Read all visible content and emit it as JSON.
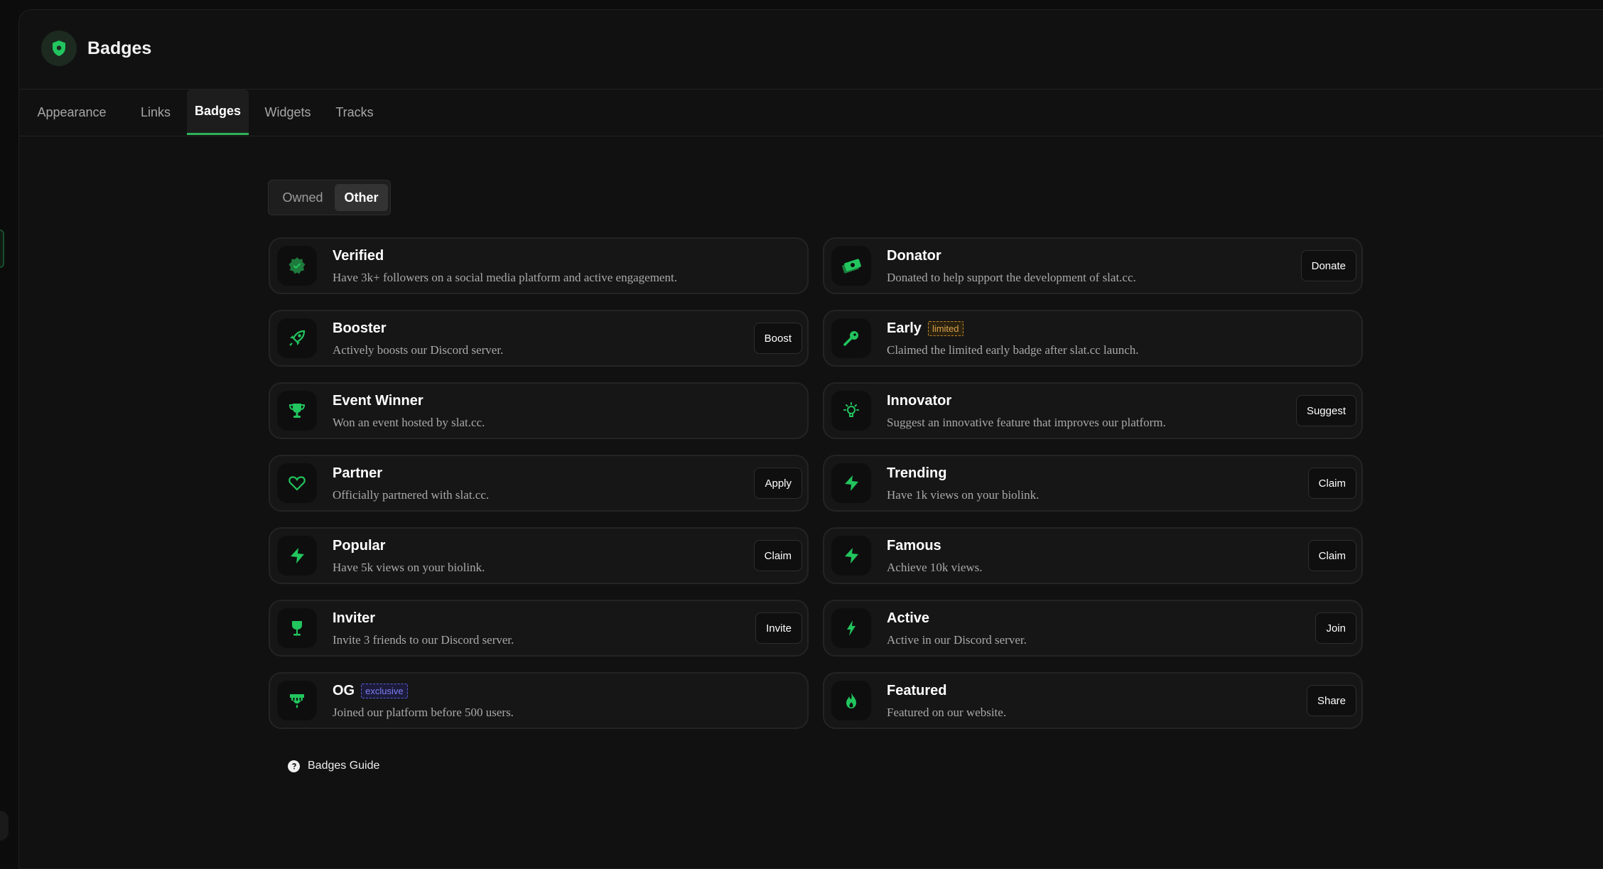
{
  "header": {
    "title": "Badges",
    "icon": "shield-icon"
  },
  "tabs": [
    {
      "label": "Appearance",
      "active": false
    },
    {
      "label": "Links",
      "active": false
    },
    {
      "label": "Badges",
      "active": true
    },
    {
      "label": "Widgets",
      "active": false
    },
    {
      "label": "Tracks",
      "active": false
    }
  ],
  "filter": {
    "owned_label": "Owned",
    "other_label": "Other",
    "selected": "Other"
  },
  "badges": [
    {
      "title": "Verified",
      "desc": "Have 3k+ followers on a social media platform and active engagement.",
      "icon": "verified-badge-icon",
      "button": ""
    },
    {
      "title": "Donator",
      "desc": "Donated to help support the development of slat.cc.",
      "icon": "money-icon",
      "button": "Donate"
    },
    {
      "title": "Booster",
      "desc": "Actively boosts our Discord server.",
      "icon": "rocket-icon",
      "button": "Boost"
    },
    {
      "title": "Early",
      "desc": "Claimed the limited early badge after slat.cc launch.",
      "icon": "key-icon",
      "button": "",
      "tag": "limited"
    },
    {
      "title": "Event Winner",
      "desc": "Won an event hosted by slat.cc.",
      "icon": "trophy-icon",
      "button": ""
    },
    {
      "title": "Innovator",
      "desc": "Suggest an innovative feature that improves our platform.",
      "icon": "lightbulb-icon",
      "button": "Suggest"
    },
    {
      "title": "Partner",
      "desc": "Officially partnered with slat.cc.",
      "icon": "heart-icon",
      "button": "Apply"
    },
    {
      "title": "Trending",
      "desc": "Have 1k views on your biolink.",
      "icon": "sparkle-star-icon",
      "button": "Claim"
    },
    {
      "title": "Popular",
      "desc": "Have 5k views on your biolink.",
      "icon": "sparkle-star-icon",
      "button": "Claim"
    },
    {
      "title": "Famous",
      "desc": "Achieve 10k views.",
      "icon": "sparkle-star-icon",
      "button": "Claim"
    },
    {
      "title": "Inviter",
      "desc": "Invite 3 friends to our Discord server.",
      "icon": "glass-icon",
      "button": "Invite"
    },
    {
      "title": "Active",
      "desc": "Active in our Discord server.",
      "icon": "lightning-icon",
      "button": "Join"
    },
    {
      "title": "OG",
      "desc": "Joined our platform before 500 users.",
      "icon": "og-crown-icon",
      "button": "",
      "tag": "exclusive"
    },
    {
      "title": "Featured",
      "desc": "Featured on our website.",
      "icon": "flame-icon",
      "button": "Share"
    }
  ],
  "guide": {
    "label": "Badges Guide",
    "icon": "help-circle-icon"
  },
  "colors": {
    "accent": "#2fb35a",
    "icon_green": "#22c55e",
    "background": "#111111",
    "card": "#161616"
  }
}
